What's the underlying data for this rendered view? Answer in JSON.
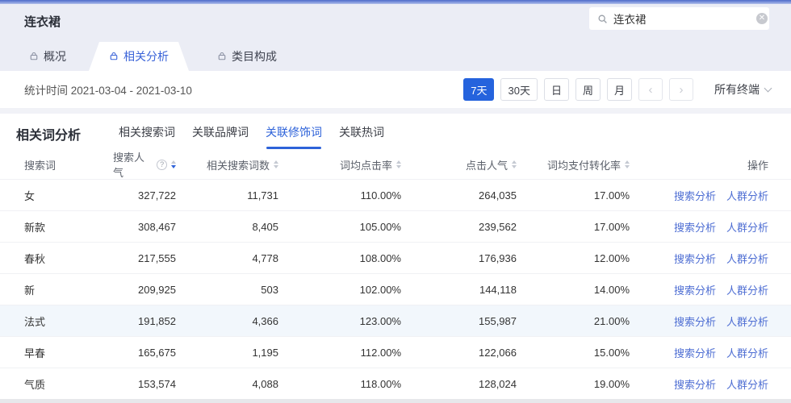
{
  "header": {
    "title": "连衣裙",
    "search": {
      "value": "连衣裙"
    }
  },
  "main_tabs": {
    "overview": "概况",
    "related_analysis": "相关分析",
    "category_composition": "类目构成",
    "active": "相关分析"
  },
  "toolbar": {
    "stats_time": "统计时间 2021-03-04 - 2021-03-10",
    "periods": {
      "d7": "7天",
      "d30": "30天",
      "day": "日",
      "week": "周",
      "month": "月"
    },
    "active_period": "7天",
    "prev": "‹",
    "next": "›",
    "terminal": "所有终端"
  },
  "section": {
    "title": "相关词分析",
    "tabs": {
      "related_search": "相关搜索词",
      "brand": "关联品牌词",
      "modifier": "关联修饰词",
      "hot": "关联热词"
    },
    "active_tab": "关联修饰词"
  },
  "table": {
    "columns": [
      "搜索词",
      "搜索人气",
      "相关搜索词数",
      "词均点击率",
      "点击人气",
      "词均支付转化率",
      "操作"
    ],
    "actions": {
      "search_analysis": "搜索分析",
      "crowd_analysis": "人群分析"
    },
    "sorted_column": "搜索人气",
    "sort_direction": "desc",
    "rows": [
      {
        "word": "女",
        "popularity": "327,722",
        "related_count": "11,731",
        "click_rate": "110.00%",
        "click_popularity": "264,035",
        "conversion": "17.00%"
      },
      {
        "word": "新款",
        "popularity": "308,467",
        "related_count": "8,405",
        "click_rate": "105.00%",
        "click_popularity": "239,562",
        "conversion": "17.00%"
      },
      {
        "word": "春秋",
        "popularity": "217,555",
        "related_count": "4,778",
        "click_rate": "108.00%",
        "click_popularity": "176,936",
        "conversion": "12.00%"
      },
      {
        "word": "新",
        "popularity": "209,925",
        "related_count": "503",
        "click_rate": "102.00%",
        "click_popularity": "144,118",
        "conversion": "14.00%"
      },
      {
        "word": "法式",
        "popularity": "191,852",
        "related_count": "4,366",
        "click_rate": "123.00%",
        "click_popularity": "155,987",
        "conversion": "21.00%"
      },
      {
        "word": "早春",
        "popularity": "165,675",
        "related_count": "1,195",
        "click_rate": "112.00%",
        "click_popularity": "122,066",
        "conversion": "15.00%"
      },
      {
        "word": "气质",
        "popularity": "153,574",
        "related_count": "4,088",
        "click_rate": "118.00%",
        "click_popularity": "128,024",
        "conversion": "19.00%"
      }
    ],
    "highlighted_row": "法式"
  },
  "colors": {
    "accent_blue": "#2563dd",
    "tab_blue": "#3a63d8",
    "link_blue": "#4e6ed3",
    "head_background": "#ebedf5",
    "row_highlight": "#f2f7fc"
  }
}
